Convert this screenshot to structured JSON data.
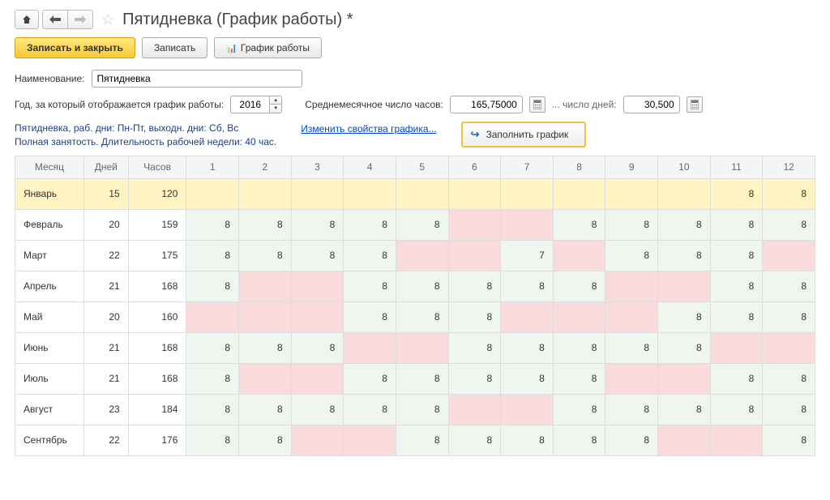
{
  "title": "Пятидневка (График работы) *",
  "toolbar": {
    "save_close": "Записать и закрыть",
    "save": "Записать",
    "schedule": "График работы"
  },
  "form": {
    "name_label": "Наименование:",
    "name_value": "Пятидневка",
    "year_label": "Год, за который отображается график работы:",
    "year_value": "2016",
    "avg_hours_label": "Среднемесячное число часов:",
    "avg_hours_value": "165,75000",
    "days_label": "... число дней:",
    "days_value": "30,500"
  },
  "info": {
    "line1": "Пятидневка, раб. дни: Пн-Пт, выходн. дни: Сб, Вс",
    "line2": "Полная занятость. Длительность рабочей недели: 40 час.",
    "edit_link": "Изменить свойства графика...",
    "fill_button": "Заполнить график"
  },
  "columns": {
    "month": "Месяц",
    "days": "Дней",
    "hours": "Часов",
    "d": [
      "1",
      "2",
      "3",
      "4",
      "5",
      "6",
      "7",
      "8",
      "9",
      "10",
      "11",
      "12"
    ]
  },
  "rows": [
    {
      "month": "Январь",
      "days": "15",
      "hours": "120",
      "selected": true,
      "cells": [
        [
          "",
          "h"
        ],
        [
          "",
          "h"
        ],
        [
          "",
          "h"
        ],
        [
          "",
          "h"
        ],
        [
          "",
          "h"
        ],
        [
          "",
          "h"
        ],
        [
          "",
          "h"
        ],
        [
          "",
          "h"
        ],
        [
          "",
          "h"
        ],
        [
          "",
          "h"
        ],
        [
          "8",
          "w"
        ],
        [
          "8",
          "w"
        ]
      ]
    },
    {
      "month": "Февраль",
      "days": "20",
      "hours": "159",
      "cells": [
        [
          "8",
          "w"
        ],
        [
          "8",
          "w"
        ],
        [
          "8",
          "w"
        ],
        [
          "8",
          "w"
        ],
        [
          "8",
          "w"
        ],
        [
          "",
          "h"
        ],
        [
          "",
          "h"
        ],
        [
          "8",
          "w"
        ],
        [
          "8",
          "w"
        ],
        [
          "8",
          "w"
        ],
        [
          "8",
          "w"
        ],
        [
          "8",
          "w"
        ]
      ]
    },
    {
      "month": "Март",
      "days": "22",
      "hours": "175",
      "cells": [
        [
          "8",
          "w"
        ],
        [
          "8",
          "w"
        ],
        [
          "8",
          "w"
        ],
        [
          "8",
          "w"
        ],
        [
          "",
          "h"
        ],
        [
          "",
          "h"
        ],
        [
          "7",
          "w"
        ],
        [
          "",
          "h"
        ],
        [
          "8",
          "w"
        ],
        [
          "8",
          "w"
        ],
        [
          "8",
          "w"
        ],
        [
          "",
          "h"
        ]
      ]
    },
    {
      "month": "Апрель",
      "days": "21",
      "hours": "168",
      "cells": [
        [
          "8",
          "w"
        ],
        [
          "",
          "h"
        ],
        [
          "",
          "h"
        ],
        [
          "8",
          "w"
        ],
        [
          "8",
          "w"
        ],
        [
          "8",
          "w"
        ],
        [
          "8",
          "w"
        ],
        [
          "8",
          "w"
        ],
        [
          "",
          "h"
        ],
        [
          "",
          "h"
        ],
        [
          "8",
          "w"
        ],
        [
          "8",
          "w"
        ]
      ]
    },
    {
      "month": "Май",
      "days": "20",
      "hours": "160",
      "cells": [
        [
          "",
          "h"
        ],
        [
          "",
          "h"
        ],
        [
          "",
          "h"
        ],
        [
          "8",
          "w"
        ],
        [
          "8",
          "w"
        ],
        [
          "8",
          "w"
        ],
        [
          "",
          "h"
        ],
        [
          "",
          "h"
        ],
        [
          "",
          "h"
        ],
        [
          "8",
          "w"
        ],
        [
          "8",
          "w"
        ],
        [
          "8",
          "w"
        ]
      ]
    },
    {
      "month": "Июнь",
      "days": "21",
      "hours": "168",
      "cells": [
        [
          "8",
          "w"
        ],
        [
          "8",
          "w"
        ],
        [
          "8",
          "w"
        ],
        [
          "",
          "h"
        ],
        [
          "",
          "h"
        ],
        [
          "8",
          "w"
        ],
        [
          "8",
          "w"
        ],
        [
          "8",
          "w"
        ],
        [
          "8",
          "w"
        ],
        [
          "8",
          "w"
        ],
        [
          "",
          "h"
        ],
        [
          "",
          "h"
        ]
      ]
    },
    {
      "month": "Июль",
      "days": "21",
      "hours": "168",
      "cells": [
        [
          "8",
          "w"
        ],
        [
          "",
          "h"
        ],
        [
          "",
          "h"
        ],
        [
          "8",
          "w"
        ],
        [
          "8",
          "w"
        ],
        [
          "8",
          "w"
        ],
        [
          "8",
          "w"
        ],
        [
          "8",
          "w"
        ],
        [
          "",
          "h"
        ],
        [
          "",
          "h"
        ],
        [
          "8",
          "w"
        ],
        [
          "8",
          "w"
        ]
      ]
    },
    {
      "month": "Август",
      "days": "23",
      "hours": "184",
      "cells": [
        [
          "8",
          "w"
        ],
        [
          "8",
          "w"
        ],
        [
          "8",
          "w"
        ],
        [
          "8",
          "w"
        ],
        [
          "8",
          "w"
        ],
        [
          "",
          "h"
        ],
        [
          "",
          "h"
        ],
        [
          "8",
          "w"
        ],
        [
          "8",
          "w"
        ],
        [
          "8",
          "w"
        ],
        [
          "8",
          "w"
        ],
        [
          "8",
          "w"
        ]
      ]
    },
    {
      "month": "Сентябрь",
      "days": "22",
      "hours": "176",
      "cells": [
        [
          "8",
          "w"
        ],
        [
          "8",
          "w"
        ],
        [
          "",
          "h"
        ],
        [
          "",
          "h"
        ],
        [
          "8",
          "w"
        ],
        [
          "8",
          "w"
        ],
        [
          "8",
          "w"
        ],
        [
          "8",
          "w"
        ],
        [
          "8",
          "w"
        ],
        [
          "",
          "h"
        ],
        [
          "",
          "h"
        ],
        [
          "8",
          "w"
        ]
      ]
    }
  ]
}
